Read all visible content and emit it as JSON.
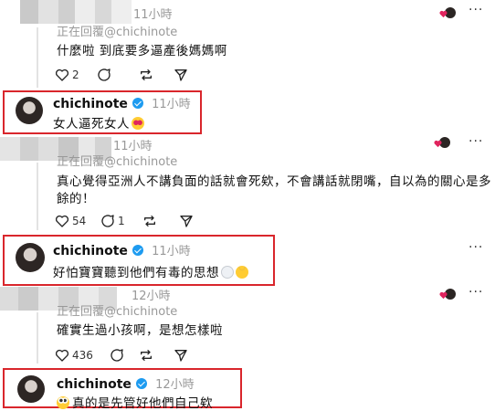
{
  "comments": [
    {
      "time": "11小時",
      "reply_to": "正在回覆@chichinote",
      "text": "什麼啦 到底要多逼產後媽媽啊",
      "likes": "2",
      "replies": ""
    },
    {
      "username": "chichinote",
      "time": "11小時",
      "text": "女人逼死女人",
      "emoji": "heart-eyes-emoji"
    },
    {
      "time": "11小時",
      "text_line1": "真心覺得亞洲人不講負面的話就會死欸，不會講話就閉嘴，自以為的關心是多",
      "text_line2": "餘的！",
      "likes": "54",
      "replies": "1"
    },
    {
      "username": "chichinote",
      "time": "11小時",
      "text": "好怕寶寶聽到他們有毒的思想",
      "emoji": [
        "thought-bubble-emoji",
        "angel-emoji"
      ]
    },
    {
      "time": "12小時",
      "reply_to": "正在回覆@chichinote",
      "text": "確實生過小孩啊，是想怎樣啦",
      "likes": "436",
      "replies": ""
    },
    {
      "username": "chichinote",
      "time": "12小時",
      "text": "真的是先管好他們自己欸",
      "emoji": "eye-roll-emoji"
    }
  ],
  "more_label": "···",
  "colors": {
    "highlight": "#d9262c",
    "verified": "#1d9bf0",
    "muted": "#999999",
    "like_heart": "#e0245e"
  }
}
